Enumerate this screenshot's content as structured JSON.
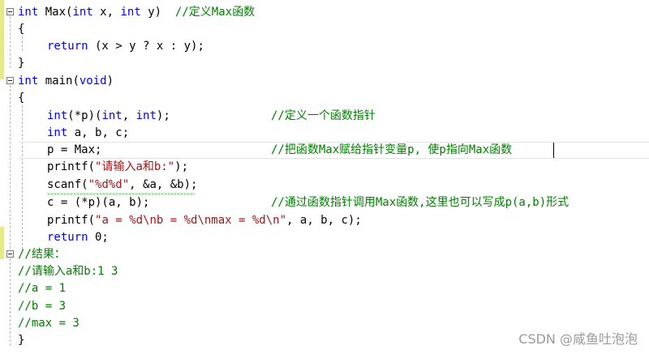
{
  "code": {
    "l1": {
      "kw": "int",
      "name": " Max",
      "p1": "(",
      "k2": "int",
      "p2": " x, ",
      "k3": "int",
      "p3": " y)  ",
      "comment": "//定义Max函数"
    },
    "l2": "{",
    "l3": {
      "kw": "return",
      "rest": " (x > y ? x : y);"
    },
    "l4": "}",
    "l5": {
      "kw": "int",
      "name": " main(",
      "k2": "void",
      "p2": ")"
    },
    "l6": "{",
    "l7": {
      "kw": "int",
      "a": "(*p)(",
      "k2": "int",
      "b": ", ",
      "k3": "int",
      "c": ");",
      "comment": "//定义一个函数指针"
    },
    "l8": {
      "kw": "int",
      "rest": " a, b, c;"
    },
    "l9": {
      "code": "p = Max;",
      "comment": "//把函数Max赋给指针变量p, 使p指向Max函数"
    },
    "l10": {
      "fn": "printf(",
      "str": "\"请输入a和b:\"",
      "end": ");"
    },
    "l11": {
      "fn": "scanf(",
      "str": "\"%d%d\"",
      "end": ", &a, &b);"
    },
    "l12": {
      "code": "c = (*p)(a, b);",
      "comment": "//通过函数指针调用Max函数,这里也可以写成p(a,b)形式"
    },
    "l13": {
      "fn": "printf(",
      "str": "\"a = %d\\nb = %d\\nmax = %d\\n\"",
      "end": ", a, b, c);"
    },
    "l14": {
      "kw": "return",
      "rest": " 0;"
    },
    "l15": "//结果：",
    "l16": "//请输入a和b:1 3",
    "l17": "//a = 1",
    "l18": "//b = 3",
    "l19": "//max = 3",
    "l20": "}"
  },
  "watermark": "CSDN @咸鱼吐泡泡",
  "colors": {
    "keyword": "#0000ff",
    "comment": "#008000",
    "string": "#a31515",
    "changebar": "#e6e98a"
  },
  "icons": {
    "fold": "fold-collapse-icon"
  }
}
